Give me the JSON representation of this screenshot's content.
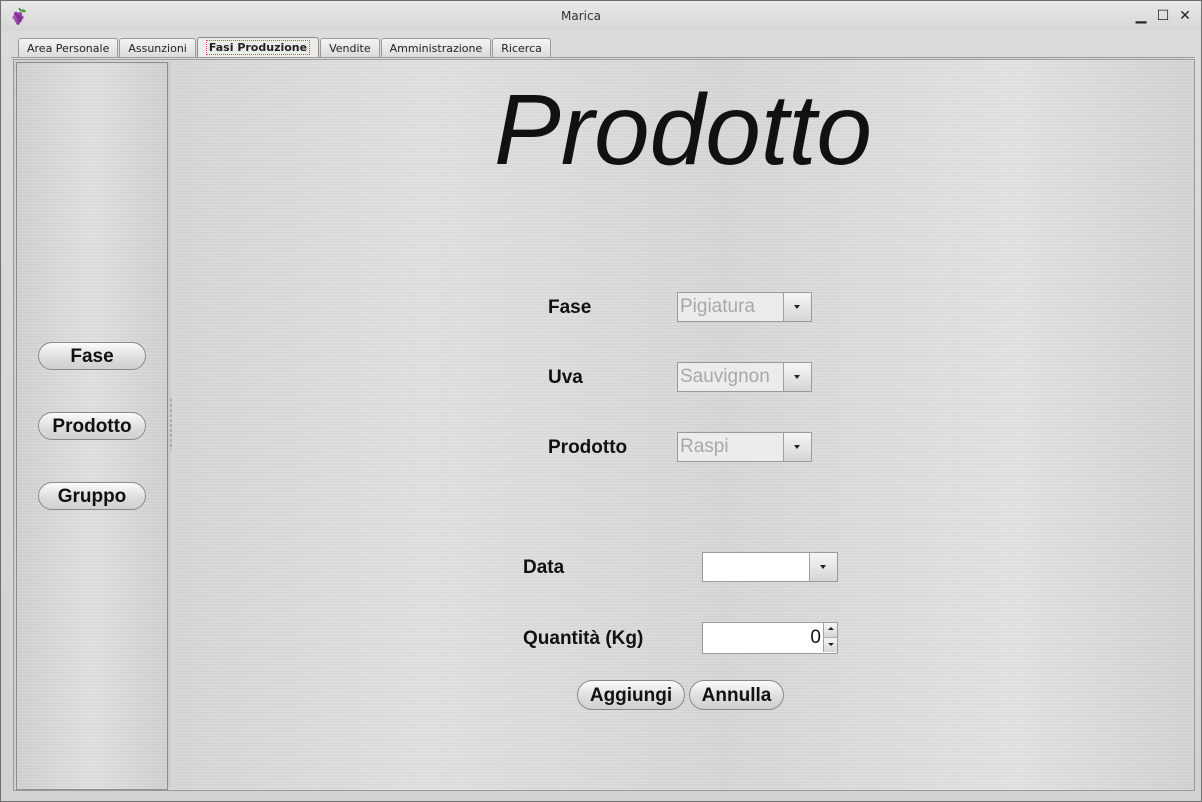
{
  "window": {
    "title": "Marica",
    "minimize_icon": "minimize-icon",
    "maximize_icon": "maximize-icon",
    "close_icon": "close-icon",
    "minimize_glyph": "▁",
    "maximize_glyph": "☐",
    "close_glyph": "✕",
    "app_icon": "grapes-icon"
  },
  "tabs": [
    {
      "label": "Area Personale",
      "active": false
    },
    {
      "label": "Assunzioni",
      "active": false
    },
    {
      "label": "Fasi Produzione",
      "active": true
    },
    {
      "label": "Vendite",
      "active": false
    },
    {
      "label": "Amministrazione",
      "active": false
    },
    {
      "label": "Ricerca",
      "active": false
    }
  ],
  "sidebar": {
    "buttons": [
      {
        "label": "Fase"
      },
      {
        "label": "Prodotto"
      },
      {
        "label": "Gruppo"
      }
    ]
  },
  "form": {
    "heading": "Prodotto",
    "fase_label": "Fase",
    "fase_value": "Pigiatura",
    "uva_label": "Uva",
    "uva_value": "Sauvignon",
    "prodotto_label": "Prodotto",
    "prodotto_value": "Raspi",
    "data_label": "Data",
    "data_value": "",
    "quantita_label": "Quantità  (Kg)",
    "quantita_value": "0",
    "aggiungi_label": "Aggiungi",
    "annulla_label": "Annulla"
  },
  "colors": {
    "disabled_text": "#a8a8a8",
    "active_tab_focus": "#d05050"
  }
}
